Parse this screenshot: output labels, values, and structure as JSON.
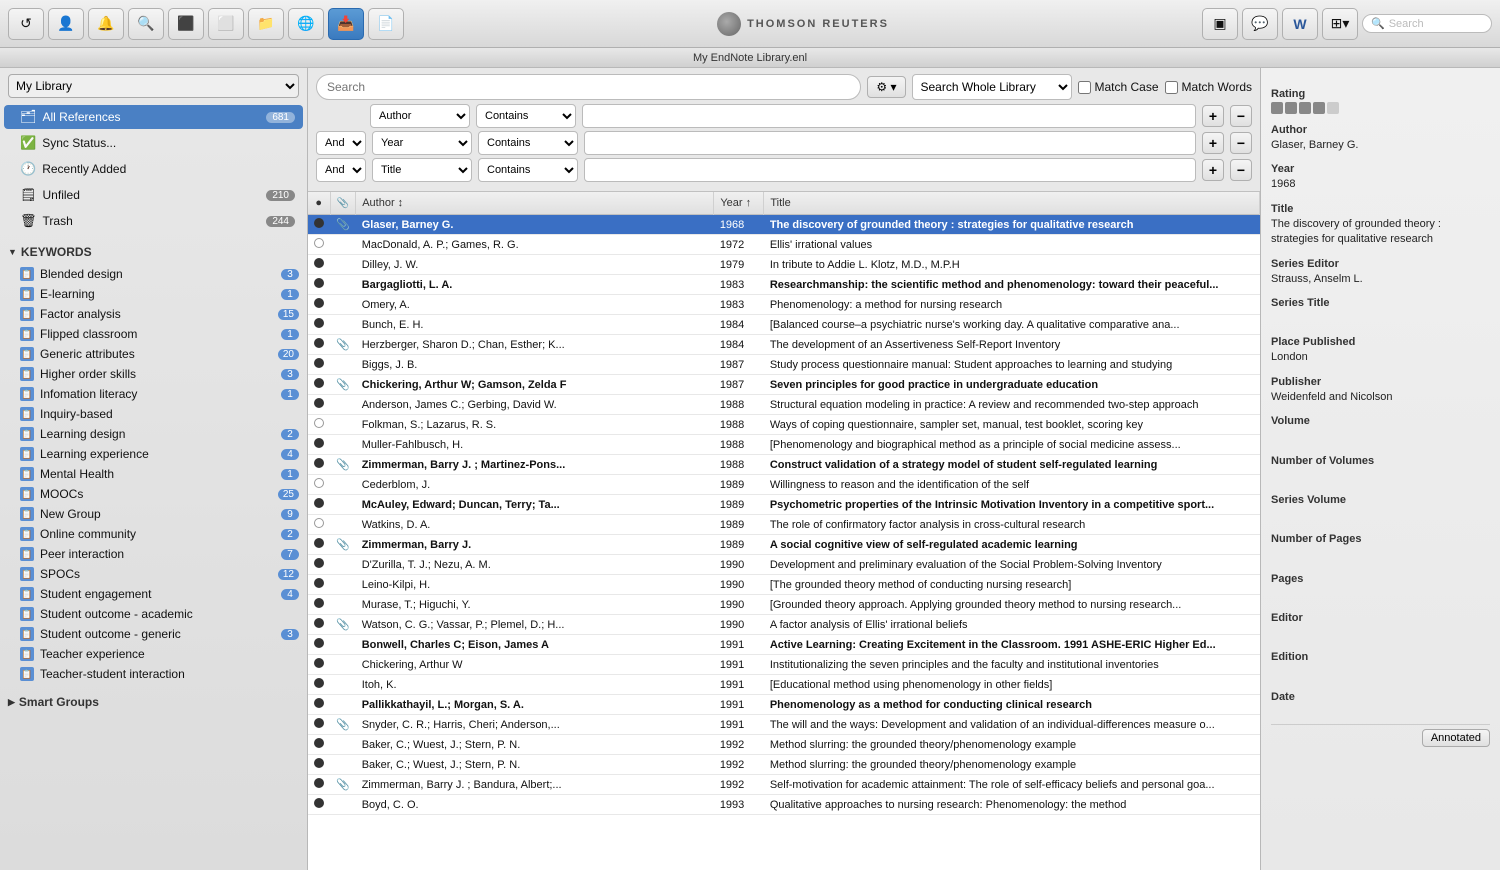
{
  "window": {
    "title": "My EndNote Library.enl"
  },
  "toolbar": {
    "buttons": [
      {
        "name": "refresh",
        "icon": "↺"
      },
      {
        "name": "add-ref",
        "icon": "👤"
      },
      {
        "name": "bell",
        "icon": "🔔"
      },
      {
        "name": "search",
        "icon": "🔍"
      },
      {
        "name": "left-panel",
        "icon": "⬛"
      },
      {
        "name": "folder",
        "icon": "📁"
      },
      {
        "name": "globe",
        "icon": "🌐"
      },
      {
        "name": "import",
        "icon": "📥"
      },
      {
        "name": "file",
        "icon": "📄"
      },
      {
        "name": "layout1",
        "icon": "▣"
      },
      {
        "name": "chat",
        "icon": "💬"
      },
      {
        "name": "word",
        "icon": "W"
      },
      {
        "name": "view-toggle",
        "icon": "⊞"
      },
      {
        "name": "search-right",
        "icon": "🔍"
      }
    ],
    "logo_text": "THOMSON REUTERS",
    "search_placeholder": "Search"
  },
  "sidebar": {
    "my_library_label": "My Library",
    "items": [
      {
        "name": "all-references",
        "icon": "🗂",
        "label": "All References",
        "badge": "681",
        "active": true
      },
      {
        "name": "sync-status",
        "icon": "✅",
        "label": "Sync Status...",
        "badge": ""
      },
      {
        "name": "recently-added",
        "icon": "🕐",
        "label": "Recently Added",
        "badge": ""
      },
      {
        "name": "unfiled",
        "icon": "🗒",
        "label": "Unfiled",
        "badge": "210"
      },
      {
        "name": "trash",
        "icon": "🗑",
        "label": "Trash",
        "badge": "244"
      }
    ],
    "keywords_section": "KEYWORDS",
    "keywords": [
      {
        "label": "Blended design",
        "badge": "3"
      },
      {
        "label": "E-learning",
        "badge": "1"
      },
      {
        "label": "Factor analysis",
        "badge": "15"
      },
      {
        "label": "Flipped classroom",
        "badge": "1"
      },
      {
        "label": "Generic attributes",
        "badge": "20"
      },
      {
        "label": "Higher order skills",
        "badge": "3"
      },
      {
        "label": "Infomation literacy",
        "badge": "1"
      },
      {
        "label": "Inquiry-based",
        "badge": ""
      },
      {
        "label": "Learning design",
        "badge": "2"
      },
      {
        "label": "Learning experience",
        "badge": "4"
      },
      {
        "label": "Mental Health",
        "badge": "1"
      },
      {
        "label": "MOOCs",
        "badge": "25"
      },
      {
        "label": "New Group",
        "badge": "9"
      },
      {
        "label": "Online community",
        "badge": "2"
      },
      {
        "label": "Peer interaction",
        "badge": "7"
      },
      {
        "label": "SPOCs",
        "badge": "12"
      },
      {
        "label": "Student engagement",
        "badge": "4"
      },
      {
        "label": "Student outcome - academic",
        "badge": ""
      },
      {
        "label": "Student outcome - generic",
        "badge": "3"
      },
      {
        "label": "Teacher experience",
        "badge": ""
      },
      {
        "label": "Teacher-student interaction",
        "badge": ""
      }
    ],
    "smart_groups_label": "Smart Groups"
  },
  "search": {
    "placeholder": "Search",
    "scope": "Search Whole Library",
    "match_case_label": "Match Case",
    "match_words_label": "Match Words",
    "rows": [
      {
        "connector": "",
        "field": "Author",
        "condition": "Contains",
        "value": ""
      },
      {
        "connector": "And",
        "field": "Year",
        "condition": "Contains",
        "value": ""
      },
      {
        "connector": "And",
        "field": "Title",
        "condition": "Contains",
        "value": ""
      }
    ]
  },
  "table": {
    "columns": [
      "",
      "",
      "Author",
      "Year",
      "Title"
    ],
    "year_sort": "asc",
    "rows": [
      {
        "dot": true,
        "attach": true,
        "author": "Glaser, Barney G.",
        "year": "1968",
        "title": "The discovery of grounded theory : strategies for qualitative research",
        "selected": true,
        "bold": true
      },
      {
        "dot": false,
        "attach": false,
        "author": "MacDonald, A. P.; Games, R. G.",
        "year": "1972",
        "title": "Ellis' irrational values",
        "selected": false
      },
      {
        "dot": true,
        "attach": false,
        "author": "Dilley, J. W.",
        "year": "1979",
        "title": "In tribute to Addie L. Klotz, M.D., M.P.H",
        "selected": false
      },
      {
        "dot": true,
        "attach": false,
        "author": "Bargagliotti, L. A.",
        "year": "1983",
        "title": "Researchmanship: the scientific method and phenomenology: toward their peaceful...",
        "selected": false,
        "bold": true
      },
      {
        "dot": true,
        "attach": false,
        "author": "Omery, A.",
        "year": "1983",
        "title": "Phenomenology: a method for nursing research",
        "selected": false
      },
      {
        "dot": true,
        "attach": false,
        "author": "Bunch, E. H.",
        "year": "1984",
        "title": "[Balanced course–a psychiatric nurse's working day. A qualitative comparative ana...",
        "selected": false
      },
      {
        "dot": true,
        "attach": true,
        "author": "Herzberger, Sharon D.; Chan, Esther; K...",
        "year": "1984",
        "title": "The development of an Assertiveness Self-Report Inventory",
        "selected": false
      },
      {
        "dot": true,
        "attach": false,
        "author": "Biggs, J. B.",
        "year": "1987",
        "title": "Study process questionnaire manual: Student approaches to learning and studying",
        "selected": false
      },
      {
        "dot": true,
        "attach": true,
        "author": "Chickering, Arthur W; Gamson, Zelda F",
        "year": "1987",
        "title": "Seven principles for good practice in undergraduate education",
        "selected": false,
        "bold": true
      },
      {
        "dot": true,
        "attach": false,
        "author": "Anderson, James C.; Gerbing, David W.",
        "year": "1988",
        "title": "Structural equation modeling in practice: A review and recommended two-step approach",
        "selected": false
      },
      {
        "dot": false,
        "attach": false,
        "author": "Folkman, S.; Lazarus, R. S.",
        "year": "1988",
        "title": "Ways of coping questionnaire, sampler set, manual, test booklet, scoring key",
        "selected": false
      },
      {
        "dot": true,
        "attach": false,
        "author": "Muller-Fahlbusch, H.",
        "year": "1988",
        "title": "[Phenomenology and biographical method as a principle of social medicine assess...",
        "selected": false
      },
      {
        "dot": true,
        "attach": true,
        "author": "Zimmerman, Barry J. ; Martinez-Pons...",
        "year": "1988",
        "title": "Construct validation of a strategy model of student self-regulated learning",
        "selected": false,
        "bold": true
      },
      {
        "dot": false,
        "attach": false,
        "author": "Cederblom, J.",
        "year": "1989",
        "title": "Willingness to reason and the identification of the self",
        "selected": false
      },
      {
        "dot": true,
        "attach": false,
        "author": "McAuley, Edward; Duncan, Terry; Ta...",
        "year": "1989",
        "title": "Psychometric properties of the Intrinsic Motivation Inventory in a competitive sport...",
        "selected": false,
        "bold": true
      },
      {
        "dot": false,
        "attach": false,
        "author": "Watkins, D. A.",
        "year": "1989",
        "title": "The role of confirmatory factor analysis in cross-cultural research",
        "selected": false
      },
      {
        "dot": true,
        "attach": true,
        "author": "Zimmerman, Barry J.",
        "year": "1989",
        "title": "A social cognitive view of self-regulated academic learning",
        "selected": false,
        "bold": true
      },
      {
        "dot": true,
        "attach": false,
        "author": "D'Zurilla, T. J.; Nezu, A. M.",
        "year": "1990",
        "title": "Development and preliminary evaluation of the Social Problem-Solving Inventory",
        "selected": false
      },
      {
        "dot": true,
        "attach": false,
        "author": "Leino-Kilpi, H.",
        "year": "1990",
        "title": "[The grounded theory method of conducting nursing research]",
        "selected": false
      },
      {
        "dot": true,
        "attach": false,
        "author": "Murase, T.; Higuchi, Y.",
        "year": "1990",
        "title": "[Grounded theory approach. Applying grounded theory method to nursing research...",
        "selected": false
      },
      {
        "dot": true,
        "attach": true,
        "author": "Watson, C. G.; Vassar, P.; Plemel, D.; H...",
        "year": "1990",
        "title": "A factor analysis of Ellis' irrational beliefs",
        "selected": false
      },
      {
        "dot": true,
        "attach": false,
        "author": "Bonwell, Charles C; Eison, James A",
        "year": "1991",
        "title": "Active Learning: Creating Excitement in the Classroom. 1991 ASHE-ERIC Higher Ed...",
        "selected": false,
        "bold": true
      },
      {
        "dot": true,
        "attach": false,
        "author": "Chickering, Arthur W",
        "year": "1991",
        "title": "Institutionalizing the seven principles and the faculty and institutional inventories",
        "selected": false
      },
      {
        "dot": true,
        "attach": false,
        "author": "Itoh, K.",
        "year": "1991",
        "title": "[Educational method using phenomenology in other fields]",
        "selected": false
      },
      {
        "dot": true,
        "attach": false,
        "author": "Pallikkathayil, L.; Morgan, S. A.",
        "year": "1991",
        "title": "Phenomenology as a method for conducting clinical research",
        "selected": false,
        "bold": true
      },
      {
        "dot": true,
        "attach": true,
        "author": "Snyder, C. R.; Harris, Cheri; Anderson,...",
        "year": "1991",
        "title": "The will and the ways: Development and validation of an individual-differences measure o...",
        "selected": false
      },
      {
        "dot": true,
        "attach": false,
        "author": "Baker, C.; Wuest, J.; Stern, P. N.",
        "year": "1992",
        "title": "Method slurring: the grounded theory/phenomenology example",
        "selected": false
      },
      {
        "dot": true,
        "attach": false,
        "author": "Baker, C.; Wuest, J.; Stern, P. N.",
        "year": "1992",
        "title": "Method slurring: the grounded theory/phenomenology example",
        "selected": false
      },
      {
        "dot": true,
        "attach": true,
        "author": "Zimmerman, Barry J. ; Bandura, Albert;...",
        "year": "1992",
        "title": "Self-motivation for academic attainment: The role of self-efficacy beliefs and personal goa...",
        "selected": false
      },
      {
        "dot": true,
        "attach": false,
        "author": "Boyd, C. O.",
        "year": "1993",
        "title": "Qualitative approaches to nursing research: Phenomenology: the method",
        "selected": false
      }
    ]
  },
  "right_panel": {
    "rating_label": "Rating",
    "stars": 4,
    "author_label": "Author",
    "author_value": "Glaser, Barney G.",
    "year_label": "Year",
    "year_value": "1968",
    "title_label": "Title",
    "title_value": "The discovery of grounded theory : strategies for qualitative research",
    "series_editor_label": "Series Editor",
    "series_editor_value": "Strauss, Anselm L.",
    "series_title_label": "Series Title",
    "series_title_value": "",
    "place_published_label": "Place Published",
    "place_published_value": "London",
    "publisher_label": "Publisher",
    "publisher_value": "Weidenfeld and Nicolson",
    "volume_label": "Volume",
    "volume_value": "",
    "num_volumes_label": "Number of Volumes",
    "num_volumes_value": "",
    "series_volume_label": "Series Volume",
    "series_volume_value": "",
    "num_pages_label": "Number of Pages",
    "num_pages_value": "",
    "pages_label": "Pages",
    "pages_value": "",
    "editor_label": "Editor",
    "editor_value": "",
    "edition_label": "Edition",
    "edition_value": "",
    "date_label": "Date",
    "date_value": "",
    "tab_label": "Annotated"
  }
}
